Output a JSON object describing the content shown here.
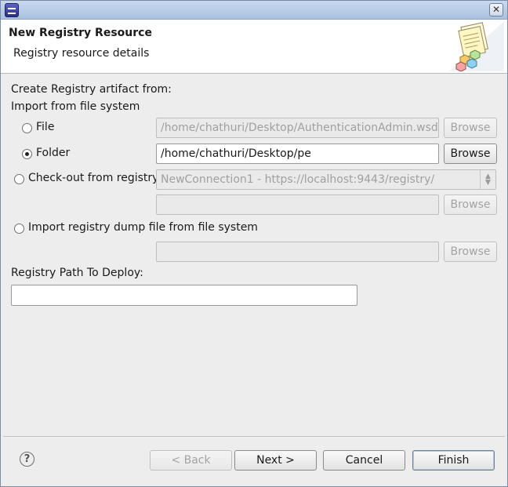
{
  "header": {
    "title": "New Registry Resource",
    "subtitle": "Registry resource details"
  },
  "form": {
    "create_label": "Create Registry artifact from:",
    "import_label": "Import from file system",
    "options": [
      {
        "label": "File",
        "checked": false,
        "value": "/home/chathuri/Desktop/AuthenticationAdmin.wsdl",
        "browse": "Browse",
        "enabled": false
      },
      {
        "label": "Folder",
        "checked": true,
        "value": "/home/chathuri/Desktop/pe",
        "browse": "Browse",
        "enabled": true
      },
      {
        "label": "Check-out from registry",
        "checked": false,
        "combo_value": "NewConnection1 - https://localhost:9443/registry/",
        "value": "",
        "browse": "Browse",
        "enabled": false
      },
      {
        "label": "Import registry dump file from file system",
        "checked": false,
        "value": "",
        "browse": "Browse",
        "enabled": false
      }
    ],
    "deploy_label": "Registry Path To Deploy:",
    "deploy_value": ""
  },
  "footer": {
    "help_icon": "question-mark-icon",
    "back": "< Back",
    "next": "Next >",
    "cancel": "Cancel",
    "finish": "Finish"
  }
}
